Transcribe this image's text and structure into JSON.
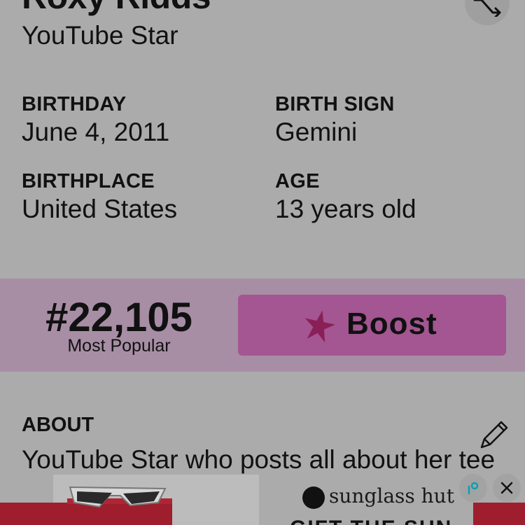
{
  "profile": {
    "name": "Roxy Ridds",
    "subtitle": "YouTube Star"
  },
  "info": {
    "birthday_label": "BIRTHDAY",
    "birthday_value": "June 4, 2011",
    "birth_sign_label": "BIRTH SIGN",
    "birth_sign_value": "Gemini",
    "birthplace_label": "BIRTHPLACE",
    "birthplace_value": "United States",
    "age_label": "AGE",
    "age_value": "13 years old"
  },
  "rank": {
    "number": "#22,105",
    "label": "Most Popular"
  },
  "boost": {
    "label": "Boost",
    "icon": "star-icon",
    "star_color": "#8a1f57"
  },
  "about": {
    "label": "ABOUT",
    "text": "YouTube Star who posts all about her tee"
  },
  "ad": {
    "brand": "sunglass hut",
    "tagline": "GIFT THE SUN",
    "accent_color": "#9e1e2d"
  },
  "icons": {
    "shuffle": "shuffle-icon",
    "edit": "pencil-icon",
    "ad_info": "ad-choices-icon",
    "ad_close": "close-icon"
  }
}
